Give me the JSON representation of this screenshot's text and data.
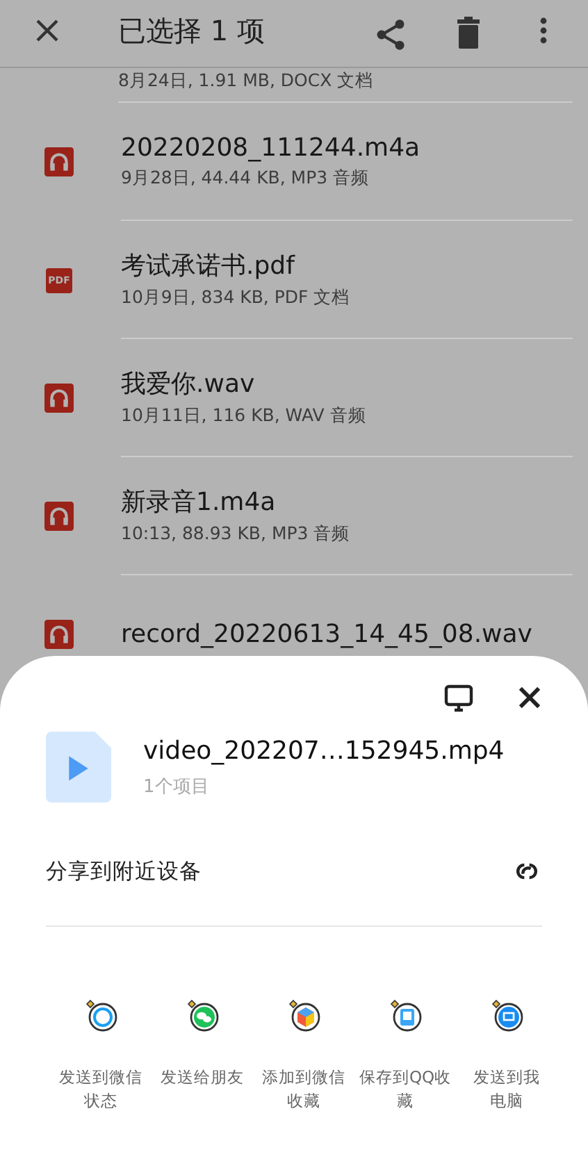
{
  "header": {
    "title": "已选择 1 项"
  },
  "files": [
    {
      "meta": "8月24日, 1.91 MB, DOCX 文档"
    },
    {
      "kind": "audio",
      "name": "20220208_111244.m4a",
      "meta": "9月28日, 44.44 KB, MP3 音频"
    },
    {
      "kind": "pdf",
      "icon_text": "PDF",
      "name": "考试承诺书.pdf",
      "meta": "10月9日, 834 KB, PDF 文档"
    },
    {
      "kind": "audio",
      "name": "我爱你.wav",
      "meta": "10月11日, 116 KB, WAV 音频"
    },
    {
      "kind": "audio",
      "name": "新录音1.m4a",
      "meta": "10:13, 88.93 KB, MP3 音频"
    },
    {
      "kind": "audio",
      "name": "record_20220613_14_45_08.wav"
    }
  ],
  "sheet": {
    "file_name": "video_202207…152945.mp4",
    "file_count": "1个项目",
    "nearby": "分享到附近设备",
    "targets": [
      {
        "kind": "status",
        "lines": [
          "发送到微信",
          "状态"
        ]
      },
      {
        "kind": "chat",
        "lines": [
          "发送给朋友"
        ]
      },
      {
        "kind": "favorite",
        "lines": [
          "添加到微信",
          "收藏"
        ]
      },
      {
        "kind": "qq",
        "lines": [
          "保存到QQ收",
          "藏"
        ]
      },
      {
        "kind": "pc",
        "lines": [
          "发送到我",
          "电脑"
        ]
      }
    ]
  }
}
